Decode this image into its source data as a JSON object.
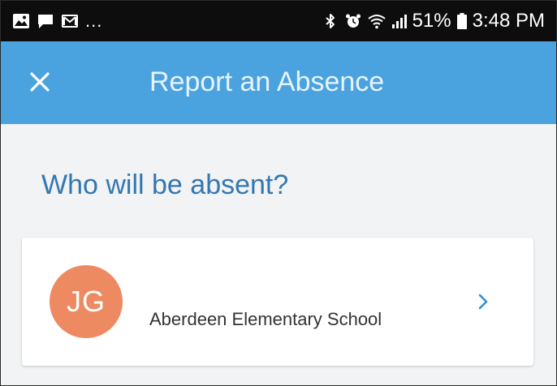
{
  "status_bar": {
    "left_icons": [
      "image-icon",
      "chat-icon",
      "gmail-icon"
    ],
    "overflow": "...",
    "right_icons": [
      "bluetooth-icon",
      "alarm-icon",
      "wifi-icon",
      "signal-icon"
    ],
    "battery": "51%",
    "battery_icon": "battery-icon",
    "time": "3:48 PM"
  },
  "app_bar": {
    "close_icon": "close-icon",
    "title": "Report an Absence",
    "background_color": "#4aa3df"
  },
  "main": {
    "question": "Who will be absent?",
    "student": {
      "initials": "JG",
      "school": "Aberdeen Elementary School",
      "avatar_color": "#ee8a62",
      "chevron_icon": "chevron-right-icon"
    }
  }
}
